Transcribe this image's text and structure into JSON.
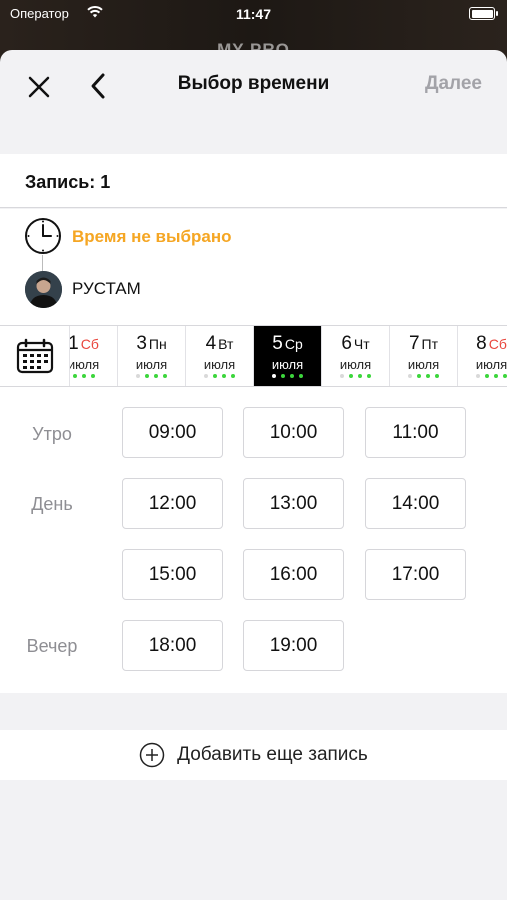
{
  "status_bar": {
    "carrier": "Оператор",
    "time": "11:47"
  },
  "background_title": "MY PRO",
  "nav": {
    "title": "Выбор времени",
    "next_label": "Далее"
  },
  "record": {
    "title": "Запись: 1",
    "time_status": "Время не выбрано",
    "master_name": "РУСТАМ"
  },
  "date_strip": {
    "days": [
      {
        "num": "1",
        "weekday": "Сб",
        "month": "июля",
        "weekend": true,
        "slots": [
          true,
          true,
          true
        ],
        "selected": false
      },
      {
        "num": "3",
        "weekday": "Пн",
        "month": "июля",
        "weekend": false,
        "slots": [
          false,
          true,
          true,
          true
        ],
        "selected": false
      },
      {
        "num": "4",
        "weekday": "Вт",
        "month": "июля",
        "weekend": false,
        "slots": [
          false,
          true,
          true,
          true
        ],
        "selected": false
      },
      {
        "num": "5",
        "weekday": "Ср",
        "month": "июля",
        "weekend": false,
        "slots": [
          false,
          true,
          true,
          true
        ],
        "selected": true
      },
      {
        "num": "6",
        "weekday": "Чт",
        "month": "июля",
        "weekend": false,
        "slots": [
          false,
          true,
          true,
          true
        ],
        "selected": false
      },
      {
        "num": "7",
        "weekday": "Пт",
        "month": "июля",
        "weekend": false,
        "slots": [
          false,
          true,
          true,
          true
        ],
        "selected": false
      },
      {
        "num": "8",
        "weekday": "Сб",
        "month": "июля",
        "weekend": true,
        "slots": [
          false,
          true,
          true,
          true
        ],
        "selected": false
      }
    ]
  },
  "periods": {
    "morning": "Утро",
    "day": "День",
    "evening": "Вечер"
  },
  "time_slots": {
    "morning": [
      "09:00",
      "10:00",
      "11:00"
    ],
    "day": [
      "12:00",
      "13:00",
      "14:00",
      "15:00",
      "16:00",
      "17:00"
    ],
    "evening": [
      "18:00",
      "19:00"
    ]
  },
  "add_record_label": "Добавить еще запись",
  "colors": {
    "accent": "#f5a623",
    "available": "#3cd63c",
    "weekend": "#e9463d",
    "selected_day": "#000000"
  }
}
